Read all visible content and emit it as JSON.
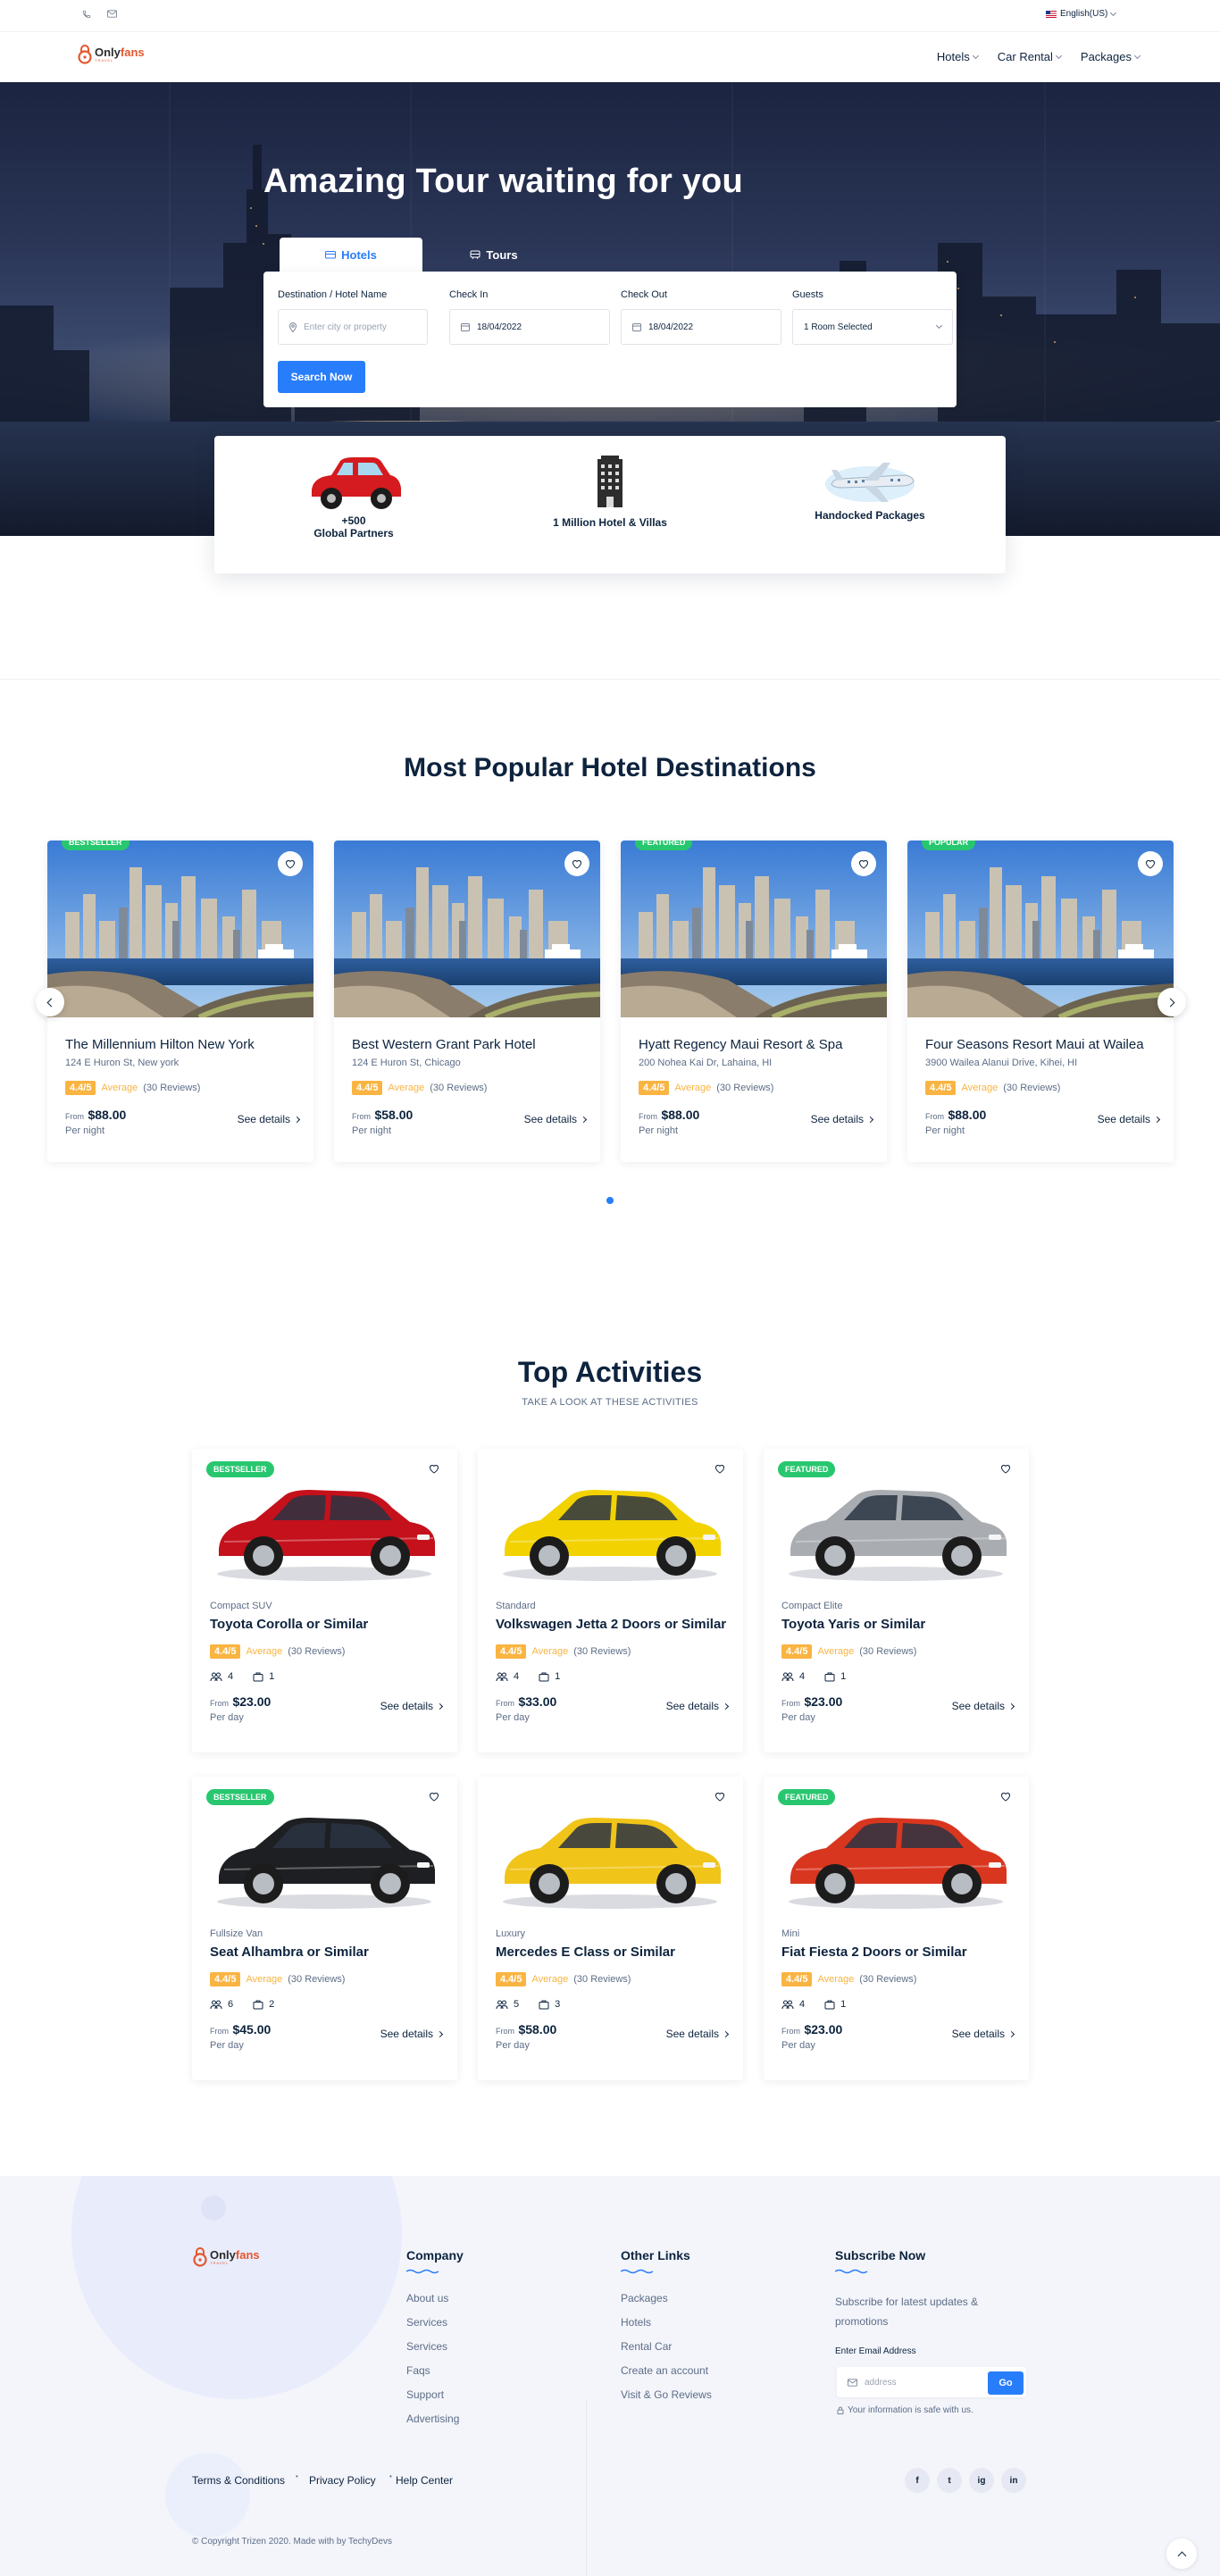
{
  "topbar": {
    "language": "English(US)",
    "icons": [
      "phone-icon",
      "mail-icon"
    ]
  },
  "nav": {
    "logo_a": "Only",
    "logo_b": "fans",
    "logo_sub": "TRAVEL",
    "items": [
      {
        "label": "Hotels"
      },
      {
        "label": "Car Rental"
      },
      {
        "label": "Packages"
      }
    ]
  },
  "hero": {
    "title": "Amazing Tour waiting for you",
    "tabs": [
      {
        "label": "Hotels"
      },
      {
        "label": "Tours"
      }
    ],
    "fields": {
      "destination": {
        "label": "Destination / Hotel Name",
        "placeholder": "Enter city or property"
      },
      "checkin": {
        "label": "Check In",
        "value": "18/04/2022"
      },
      "checkout": {
        "label": "Check Out",
        "value": "18/04/2022"
      },
      "guests": {
        "label": "Guests",
        "value": "1 Room Selected"
      }
    },
    "search_button": "Search Now"
  },
  "features": [
    {
      "line1": "+500",
      "line2": "Global Partners"
    },
    {
      "line1": "1 Million Hotel & Villas"
    },
    {
      "line1": "Handocked Packages"
    }
  ],
  "hotels": {
    "title": "Most Popular Hotel Destinations",
    "cards": [
      {
        "badge": "BESTSELLER",
        "name": "The Millennium Hilton New York",
        "address": "124 E Huron St, New york",
        "score": "4.4/5",
        "avg": "Average",
        "reviews": "(30 Reviews)",
        "from": "From",
        "price": "$88.00",
        "per": "Per night",
        "see": "See details"
      },
      {
        "badge": "",
        "name": "Best Western Grant Park Hotel",
        "address": "124 E Huron St, Chicago",
        "score": "4.4/5",
        "avg": "Average",
        "reviews": "(30 Reviews)",
        "from": "From",
        "price": "$58.00",
        "per": "Per night",
        "see": "See details"
      },
      {
        "badge": "FEATURED",
        "name": "Hyatt Regency Maui Resort & Spa",
        "address": "200 Nohea Kai Dr, Lahaina, HI",
        "score": "4.4/5",
        "avg": "Average",
        "reviews": "(30 Reviews)",
        "from": "From",
        "price": "$88.00",
        "per": "Per night",
        "see": "See details"
      },
      {
        "badge": "POPULAR",
        "name": "Four Seasons Resort Maui at Wailea",
        "address": "3900 Wailea Alanui Drive, Kihei, HI",
        "score": "4.4/5",
        "avg": "Average",
        "reviews": "(30 Reviews)",
        "from": "From",
        "price": "$88.00",
        "per": "Per night",
        "see": "See details"
      }
    ]
  },
  "activities": {
    "title": "Top Activities",
    "subtitle": "TAKE A LOOK AT THESE ACTIVITIES",
    "cards": [
      {
        "badge": "BESTSELLER",
        "type": "Compact SUV",
        "name": "Toyota Corolla or Similar",
        "score": "4.4/5",
        "avg": "Average",
        "reviews": "(30 Reviews)",
        "seats": "4",
        "bags": "1",
        "from": "From",
        "price": "$23.00",
        "per": "Per day",
        "see": "See details",
        "color": "#c4111b"
      },
      {
        "badge": "",
        "type": "Standard",
        "name": "Volkswagen Jetta 2 Doors or Similar",
        "score": "4.4/5",
        "avg": "Average",
        "reviews": "(30 Reviews)",
        "seats": "4",
        "bags": "1",
        "from": "From",
        "price": "$33.00",
        "per": "Per day",
        "see": "See details",
        "color": "#f2d200"
      },
      {
        "badge": "FEATURED",
        "type": "Compact Elite",
        "name": "Toyota Yaris or Similar",
        "score": "4.4/5",
        "avg": "Average",
        "reviews": "(30 Reviews)",
        "seats": "4",
        "bags": "1",
        "from": "From",
        "price": "$23.00",
        "per": "Per day",
        "see": "See details",
        "color": "#a9acb1"
      },
      {
        "badge": "BESTSELLER",
        "type": "Fullsize Van",
        "name": "Seat Alhambra or Similar",
        "score": "4.4/5",
        "avg": "Average",
        "reviews": "(30 Reviews)",
        "seats": "6",
        "bags": "2",
        "from": "From",
        "price": "$45.00",
        "per": "Per day",
        "see": "See details",
        "color": "#1d1f22"
      },
      {
        "badge": "",
        "type": "Luxury",
        "name": "Mercedes E Class or Similar",
        "score": "4.4/5",
        "avg": "Average",
        "reviews": "(30 Reviews)",
        "seats": "5",
        "bags": "3",
        "from": "From",
        "price": "$58.00",
        "per": "Per day",
        "see": "See details",
        "color": "#f0c419"
      },
      {
        "badge": "FEATURED",
        "type": "Mini",
        "name": "Fiat Fiesta 2 Doors or Similar",
        "score": "4.4/5",
        "avg": "Average",
        "reviews": "(30 Reviews)",
        "seats": "4",
        "bags": "1",
        "from": "From",
        "price": "$23.00",
        "per": "Per day",
        "see": "See details",
        "color": "#d9361f"
      }
    ]
  },
  "footer": {
    "company": {
      "title": "Company",
      "links": [
        "About us",
        "Services",
        "Services",
        "Faqs",
        "Support",
        "Advertising"
      ]
    },
    "other": {
      "title": "Other Links",
      "links": [
        "Packages",
        "Hotels",
        "Rental Car",
        "Create an account",
        "Visit & Go Reviews"
      ]
    },
    "subscribe": {
      "title": "Subscribe Now",
      "text1": "Subscribe for latest updates &",
      "text2": "promotions",
      "email_label": "Enter Email Address",
      "placeholder": "address",
      "go": "Go",
      "safe": "Your information is safe with us."
    },
    "bottom_links": [
      "Terms & Conditions",
      "Privacy Policy",
      "Help Center"
    ],
    "social": [
      "f",
      "t",
      "ig",
      "in"
    ],
    "copyright": "© Copyright Trizen 2020. Made with by TechyDevs"
  },
  "colors": {
    "accent": "#287dfa",
    "badge_green": "#28c76f",
    "rating": "#f9b442",
    "navy": "#0d233e"
  }
}
